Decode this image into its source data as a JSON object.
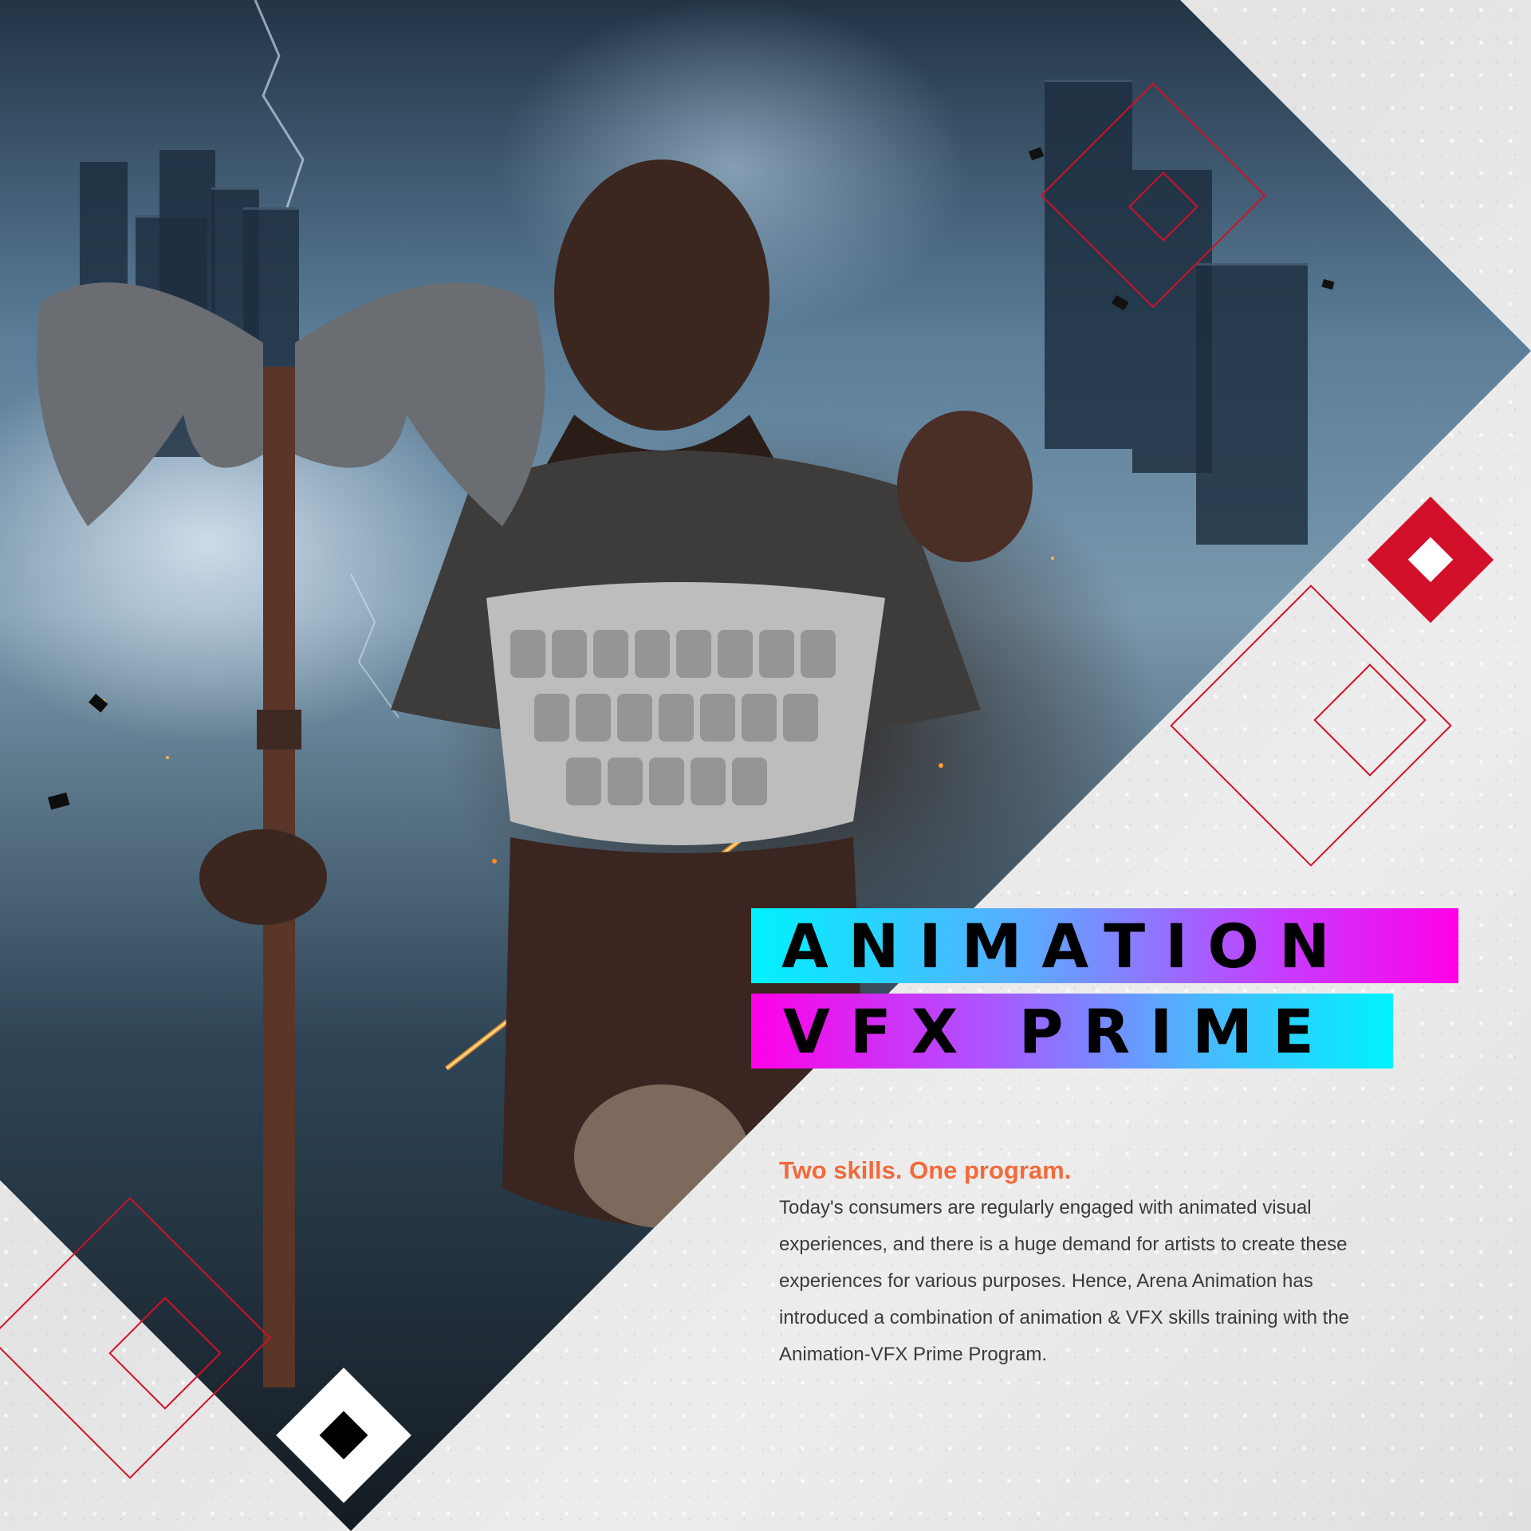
{
  "headline": {
    "line1": "ANIMATION",
    "line2": "VFX PRIME"
  },
  "tagline": "Two skills. One program.",
  "body": "Today's consumers are regularly engaged with animated visual experiences, and there is a huge demand for artists to create these experiences for various purposes. Hence, Arena Animation has introduced a combination of animation & VFX skills training with the Animation-VFX Prime Program.",
  "hero_image": {
    "subject": "warrior with double-bladed axe, scale armor and fur, ruined city skyline with lightning and flying debris"
  },
  "colors": {
    "accent_red": "#d2102a",
    "tagline_orange": "#f26a3a",
    "gradient_cyan": "#00f2ff",
    "gradient_magenta": "#ff00e6",
    "background": "#ececec",
    "headline_text": "#000000",
    "body_text": "#3a3a3a"
  },
  "icons": [
    "outline-diamond-icon",
    "filled-red-diamond-icon",
    "filled-white-diamond-icon"
  ]
}
